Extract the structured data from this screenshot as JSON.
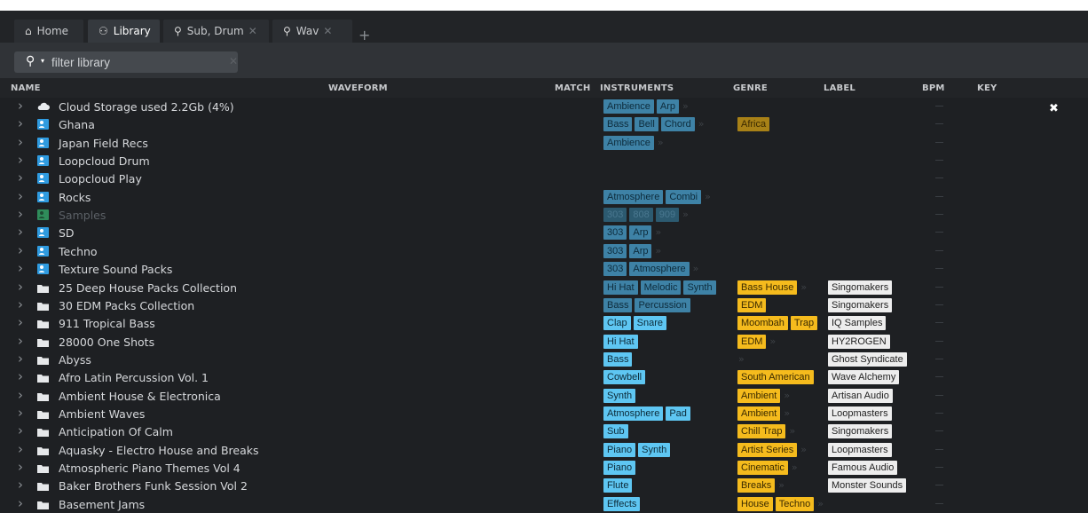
{
  "tabs": [
    {
      "label": "Home",
      "icon": "home-icon",
      "closable": false,
      "active": false
    },
    {
      "label": "Library",
      "icon": "user-icon",
      "closable": false,
      "active": true
    },
    {
      "label": "Sub, Drum",
      "icon": "search-icon",
      "closable": true,
      "active": false
    },
    {
      "label": "Wav",
      "icon": "search-icon",
      "closable": true,
      "active": false
    }
  ],
  "filter": {
    "placeholder": "filter library"
  },
  "columns": {
    "name": "NAME",
    "waveform": "WAVEFORM",
    "match": "MATCH",
    "instruments": "INSTRUMENTS",
    "genre": "GENRE",
    "label": "LABEL",
    "bpm": "BPM",
    "key": "KEY"
  },
  "colors": {
    "instrument_tag": "#4a9fca",
    "genre_tag": "#f5bb1d",
    "label_tag": "#ededed",
    "background": "#1e2023"
  },
  "rows": [
    {
      "name": "Cloud Storage used 2.2Gb (4%)",
      "icon": "cloud-icon",
      "instruments": [
        "Ambience",
        "Arp"
      ],
      "instruments_more": true,
      "genre": [],
      "label": []
    },
    {
      "name": "Ghana",
      "icon": "user-folder-icon",
      "instruments": [
        "Bass",
        "Bell",
        "Chord"
      ],
      "instruments_more": true,
      "genre": [
        "Africa"
      ],
      "label": []
    },
    {
      "name": "Japan Field Recs",
      "icon": "user-folder-icon",
      "instruments": [
        "Ambience"
      ],
      "instruments_more": true,
      "genre": [],
      "label": []
    },
    {
      "name": "Loopcloud Drum",
      "icon": "user-folder-icon",
      "instruments": [],
      "genre": [],
      "label": []
    },
    {
      "name": "Loopcloud Play",
      "icon": "user-folder-icon",
      "instruments": [],
      "genre": [],
      "label": []
    },
    {
      "name": "Rocks",
      "icon": "user-folder-icon",
      "instruments": [
        "Atmosphere",
        "Combi"
      ],
      "instruments_more": true,
      "genre": [],
      "label": []
    },
    {
      "name": "Samples",
      "icon": "disabled-folder-icon",
      "dim": true,
      "instruments": [
        "303",
        "808",
        "909"
      ],
      "instruments_more": true,
      "genre": [],
      "label": []
    },
    {
      "name": "SD",
      "icon": "user-folder-icon",
      "instruments": [
        "303",
        "Arp"
      ],
      "instruments_more": true,
      "genre": [],
      "label": []
    },
    {
      "name": "Techno",
      "icon": "user-folder-icon",
      "instruments": [
        "303",
        "Arp"
      ],
      "instruments_more": true,
      "genre": [],
      "label": []
    },
    {
      "name": "Texture Sound Packs",
      "icon": "user-folder-icon",
      "instruments": [
        "303",
        "Atmosphere"
      ],
      "instruments_more": true,
      "genre": [],
      "label": []
    },
    {
      "name": "25 Deep House Packs Collection",
      "icon": "folder-icon",
      "instruments": [
        "Hi Hat",
        "Melodic",
        "Synth"
      ],
      "instruments_more": false,
      "genre": [
        "Bass House"
      ],
      "genre_more": true,
      "label": [
        "Singomakers"
      ]
    },
    {
      "name": "30 EDM Packs Collection",
      "icon": "folder-icon",
      "instruments": [
        "Bass",
        "Percussion"
      ],
      "instruments_more": false,
      "genre": [
        "EDM"
      ],
      "label": [
        "Singomakers"
      ]
    },
    {
      "name": "911 Tropical Bass",
      "icon": "folder-icon",
      "instruments": [
        "Clap",
        "Snare"
      ],
      "instruments_more": false,
      "genre": [
        "Moombah",
        "Trap"
      ],
      "label": [
        "IQ Samples"
      ]
    },
    {
      "name": "28000 One Shots",
      "icon": "folder-icon",
      "instruments": [
        "Hi Hat"
      ],
      "instruments_more": false,
      "genre": [
        "EDM"
      ],
      "genre_more": true,
      "label": [
        "HY2ROGEN"
      ]
    },
    {
      "name": "Abyss",
      "icon": "folder-icon",
      "instruments": [
        "Bass"
      ],
      "instruments_more": false,
      "genre": [],
      "genre_more": true,
      "label": [
        "Ghost Syndicate"
      ]
    },
    {
      "name": "Afro Latin Percussion Vol. 1",
      "icon": "folder-icon",
      "instruments": [
        "Cowbell"
      ],
      "instruments_more": false,
      "genre": [
        "South American"
      ],
      "label": [
        "Wave Alchemy"
      ]
    },
    {
      "name": "Ambient House & Electronica",
      "icon": "folder-icon",
      "instruments": [
        "Synth"
      ],
      "instruments_more": false,
      "genre": [
        "Ambient"
      ],
      "genre_more": true,
      "label": [
        "Artisan Audio"
      ]
    },
    {
      "name": "Ambient Waves",
      "icon": "folder-icon",
      "instruments": [
        "Atmosphere",
        "Pad"
      ],
      "instruments_more": false,
      "genre": [
        "Ambient"
      ],
      "genre_more": true,
      "label": [
        "Loopmasters"
      ]
    },
    {
      "name": "Anticipation Of Calm",
      "icon": "folder-icon",
      "instruments": [
        "Sub"
      ],
      "instruments_more": false,
      "genre": [
        "Chill Trap"
      ],
      "genre_more": true,
      "label": [
        "Singomakers"
      ]
    },
    {
      "name": "Aquasky - Electro House and Breaks",
      "icon": "folder-icon",
      "instruments": [
        "Piano",
        "Synth"
      ],
      "instruments_more": false,
      "genre": [
        "Artist Series"
      ],
      "genre_more": true,
      "label": [
        "Loopmasters"
      ]
    },
    {
      "name": "Atmospheric Piano Themes Vol 4",
      "icon": "folder-icon",
      "instruments": [
        "Piano"
      ],
      "instruments_more": false,
      "genre": [
        "Cinematic"
      ],
      "genre_more": true,
      "label": [
        "Famous Audio"
      ]
    },
    {
      "name": "Baker Brothers Funk Session Vol 2",
      "icon": "folder-icon",
      "instruments": [
        "Flute"
      ],
      "instruments_more": false,
      "genre": [
        "Breaks"
      ],
      "genre_more": true,
      "label": [
        "Monster Sounds"
      ]
    },
    {
      "name": "Basement Jams",
      "icon": "folder-icon",
      "instruments": [
        "Effects"
      ],
      "instruments_more": false,
      "genre": [
        "House",
        "Techno"
      ],
      "genre_more": true,
      "label": []
    }
  ]
}
